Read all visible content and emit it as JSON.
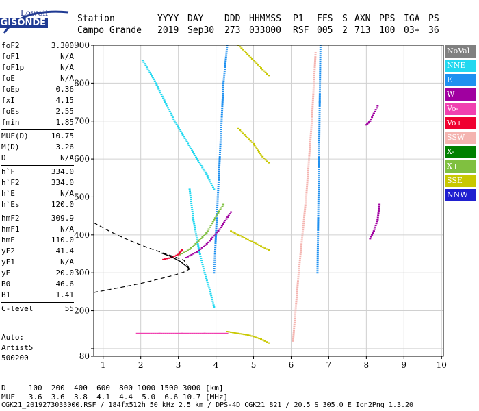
{
  "logo": {
    "top": "Lowell",
    "bottom": "DIGISONDE"
  },
  "header": {
    "labels": [
      "Station",
      "YYYY",
      "DAY",
      "DDD",
      "HHMMSS",
      "P1",
      "FFS",
      "S",
      "AXN",
      "PPS",
      "IGA",
      "PS"
    ],
    "values": [
      "Campo Grande",
      "2019",
      "Sep30",
      "273",
      "033000",
      "RSF",
      "005",
      "2",
      "713",
      "100",
      "03+",
      "36"
    ]
  },
  "params": [
    {
      "group": [
        {
          "label": "foF2",
          "value": "3.300"
        },
        {
          "label": "foF1",
          "value": "N/A"
        },
        {
          "label": "foF1p",
          "value": "N/A"
        },
        {
          "label": "foE",
          "value": "N/A"
        },
        {
          "label": "foEp",
          "value": "0.36"
        },
        {
          "label": "fxI",
          "value": "4.15"
        },
        {
          "label": "foEs",
          "value": "2.55"
        },
        {
          "label": "fmin",
          "value": "1.85"
        }
      ]
    },
    {
      "group": [
        {
          "label": "MUF(D)",
          "value": "10.75"
        },
        {
          "label": "M(D)",
          "value": "3.26"
        },
        {
          "label": "D",
          "value": "N/A"
        }
      ]
    },
    {
      "group": [
        {
          "label": "h`F",
          "value": "334.0"
        },
        {
          "label": "h`F2",
          "value": "334.0"
        },
        {
          "label": "h`E",
          "value": "N/A"
        },
        {
          "label": "h`Es",
          "value": "120.0"
        }
      ]
    },
    {
      "group": [
        {
          "label": "hmF2",
          "value": "309.9"
        },
        {
          "label": "hmF1",
          "value": "N/A"
        },
        {
          "label": "hmE",
          "value": "110.0"
        },
        {
          "label": "yF2",
          "value": "41.4"
        },
        {
          "label": "yF1",
          "value": "N/A"
        },
        {
          "label": "yE",
          "value": "20.0"
        },
        {
          "label": "B0",
          "value": "46.6"
        },
        {
          "label": "B1",
          "value": "1.41"
        }
      ]
    },
    {
      "group": [
        {
          "label": "C-level",
          "value": "55"
        }
      ]
    }
  ],
  "autoscale": {
    "line1": "Auto:",
    "line2": "Artist5",
    "line3": "500200"
  },
  "legend": [
    {
      "label": "NoVal",
      "color": "#808080"
    },
    {
      "label": "NNE",
      "color": "#22d8f0"
    },
    {
      "label": "E",
      "color": "#1e90f0"
    },
    {
      "label": "W",
      "color": "#a000a0"
    },
    {
      "label": "Vo-",
      "color": "#f040b0"
    },
    {
      "label": "Vo+",
      "color": "#f00030"
    },
    {
      "label": "SSW",
      "color": "#f4b4b0"
    },
    {
      "label": "X-",
      "color": "#008000"
    },
    {
      "label": "X+",
      "color": "#80c040"
    },
    {
      "label": "SSE",
      "color": "#c8c800"
    },
    {
      "label": "NNW",
      "color": "#2020d0"
    }
  ],
  "footer": {
    "d_line": "D     100  200  400  600  800 1000 1500 3000 [km]",
    "muf_line": "MUF   3.6  3.6  3.8  4.1  4.4  5.0  6.6 10.7 [MHz]",
    "file_line": "CGK21_2019273033000.RSF / 184fx512h 50 kHz 2.5 km / DPS-4D CGK21 821 / 20.5 S 305.0 E Ion2Png 1.3.20"
  },
  "chart_data": {
    "type": "scatter",
    "title": "",
    "xlabel": "",
    "ylabel": "",
    "xlim": [
      0.75,
      10.05
    ],
    "ylim": [
      80,
      900
    ],
    "xticks": [
      1,
      2,
      3,
      4,
      5,
      6,
      7,
      8,
      9,
      10
    ],
    "yticks": [
      80,
      100,
      200,
      300,
      400,
      500,
      600,
      700,
      800,
      900
    ],
    "ytick_labels": [
      "80",
      "",
      "200",
      "300",
      "400",
      "500",
      "600",
      "700",
      "800",
      "900"
    ],
    "grid": true,
    "profile_solid": [
      [
        3.3,
        310
      ],
      [
        3.2,
        318
      ],
      [
        3.05,
        330
      ],
      [
        2.9,
        338
      ],
      [
        2.75,
        345
      ],
      [
        2.55,
        352
      ]
    ],
    "profile_dashed_upper": [
      [
        0.75,
        432
      ],
      [
        1.2,
        408
      ],
      [
        1.7,
        385
      ],
      [
        2.2,
        366
      ],
      [
        2.6,
        352
      ],
      [
        2.9,
        342
      ],
      [
        3.15,
        333
      ],
      [
        3.3,
        310
      ]
    ],
    "profile_dashed_lower": [
      [
        0.75,
        248
      ],
      [
        1.4,
        260
      ],
      [
        2.0,
        272
      ],
      [
        2.5,
        284
      ],
      [
        2.9,
        294
      ],
      [
        3.15,
        302
      ],
      [
        3.3,
        310
      ]
    ],
    "traces": [
      {
        "name": "NNE",
        "color": "#22d8f0",
        "x": [
          2.05,
          2.35,
          2.6,
          2.9,
          3.2,
          3.5,
          3.75,
          3.95
        ],
        "y": [
          860,
          810,
          760,
          700,
          650,
          600,
          560,
          520
        ]
      },
      {
        "name": "NNE",
        "color": "#22d8f0",
        "x": [
          3.3,
          3.4,
          3.55,
          3.7,
          3.85,
          3.95
        ],
        "y": [
          520,
          440,
          360,
          300,
          250,
          210
        ]
      },
      {
        "name": "E",
        "color": "#1e90f0",
        "x": [
          3.95,
          4.0,
          4.05,
          4.1,
          4.15,
          4.2,
          4.3
        ],
        "y": [
          300,
          400,
          500,
          600,
          700,
          800,
          900
        ]
      },
      {
        "name": "E",
        "color": "#1e90f0",
        "x": [
          6.7,
          6.72,
          6.74,
          6.76,
          6.78
        ],
        "y": [
          300,
          450,
          600,
          750,
          900
        ]
      },
      {
        "name": "X+",
        "color": "#80c040",
        "x": [
          3.05,
          3.3,
          3.5,
          3.75,
          3.95,
          4.2
        ],
        "y": [
          348,
          362,
          380,
          405,
          440,
          480
        ]
      },
      {
        "name": "W",
        "color": "#a000a0",
        "x": [
          3.2,
          3.5,
          3.8,
          4.1,
          4.4
        ],
        "y": [
          340,
          355,
          380,
          415,
          460
        ]
      },
      {
        "name": "Vo+",
        "color": "#f00030",
        "x": [
          2.6,
          2.8,
          3.0,
          3.1
        ],
        "y": [
          335,
          340,
          348,
          360
        ]
      },
      {
        "name": "SSE",
        "color": "#c8c800",
        "x": [
          4.4,
          4.6,
          4.8,
          5.0,
          5.2,
          5.4
        ],
        "y": [
          410,
          400,
          390,
          380,
          370,
          360
        ]
      },
      {
        "name": "SSE",
        "color": "#c8c800",
        "x": [
          4.6,
          4.8,
          5.0,
          5.2,
          5.4
        ],
        "y": [
          680,
          660,
          640,
          610,
          590
        ]
      },
      {
        "name": "SSE",
        "color": "#c8c800",
        "x": [
          4.6,
          4.8,
          5.0,
          5.2,
          5.4
        ],
        "y": [
          900,
          880,
          860,
          840,
          820
        ]
      },
      {
        "name": "SSE",
        "color": "#c8c800",
        "x": [
          4.3,
          4.6,
          4.9,
          5.2,
          5.4
        ],
        "y": [
          145,
          140,
          135,
          125,
          115
        ]
      },
      {
        "name": "SSW",
        "color": "#f4b4b0",
        "x": [
          6.05,
          6.2,
          6.4,
          6.55,
          6.65
        ],
        "y": [
          120,
          300,
          500,
          700,
          880
        ]
      },
      {
        "name": "W",
        "color": "#a000a0",
        "x": [
          8.1,
          8.2,
          8.3,
          8.35
        ],
        "y": [
          390,
          410,
          440,
          480
        ]
      },
      {
        "name": "W",
        "color": "#a000a0",
        "x": [
          8.0,
          8.1,
          8.2,
          8.3
        ],
        "y": [
          690,
          700,
          720,
          740
        ]
      },
      {
        "name": "Vo-",
        "color": "#f040b0",
        "x": [
          1.9,
          2.5,
          3.1,
          3.7,
          4.3
        ],
        "y": [
          140,
          140,
          140,
          140,
          140
        ]
      }
    ]
  }
}
